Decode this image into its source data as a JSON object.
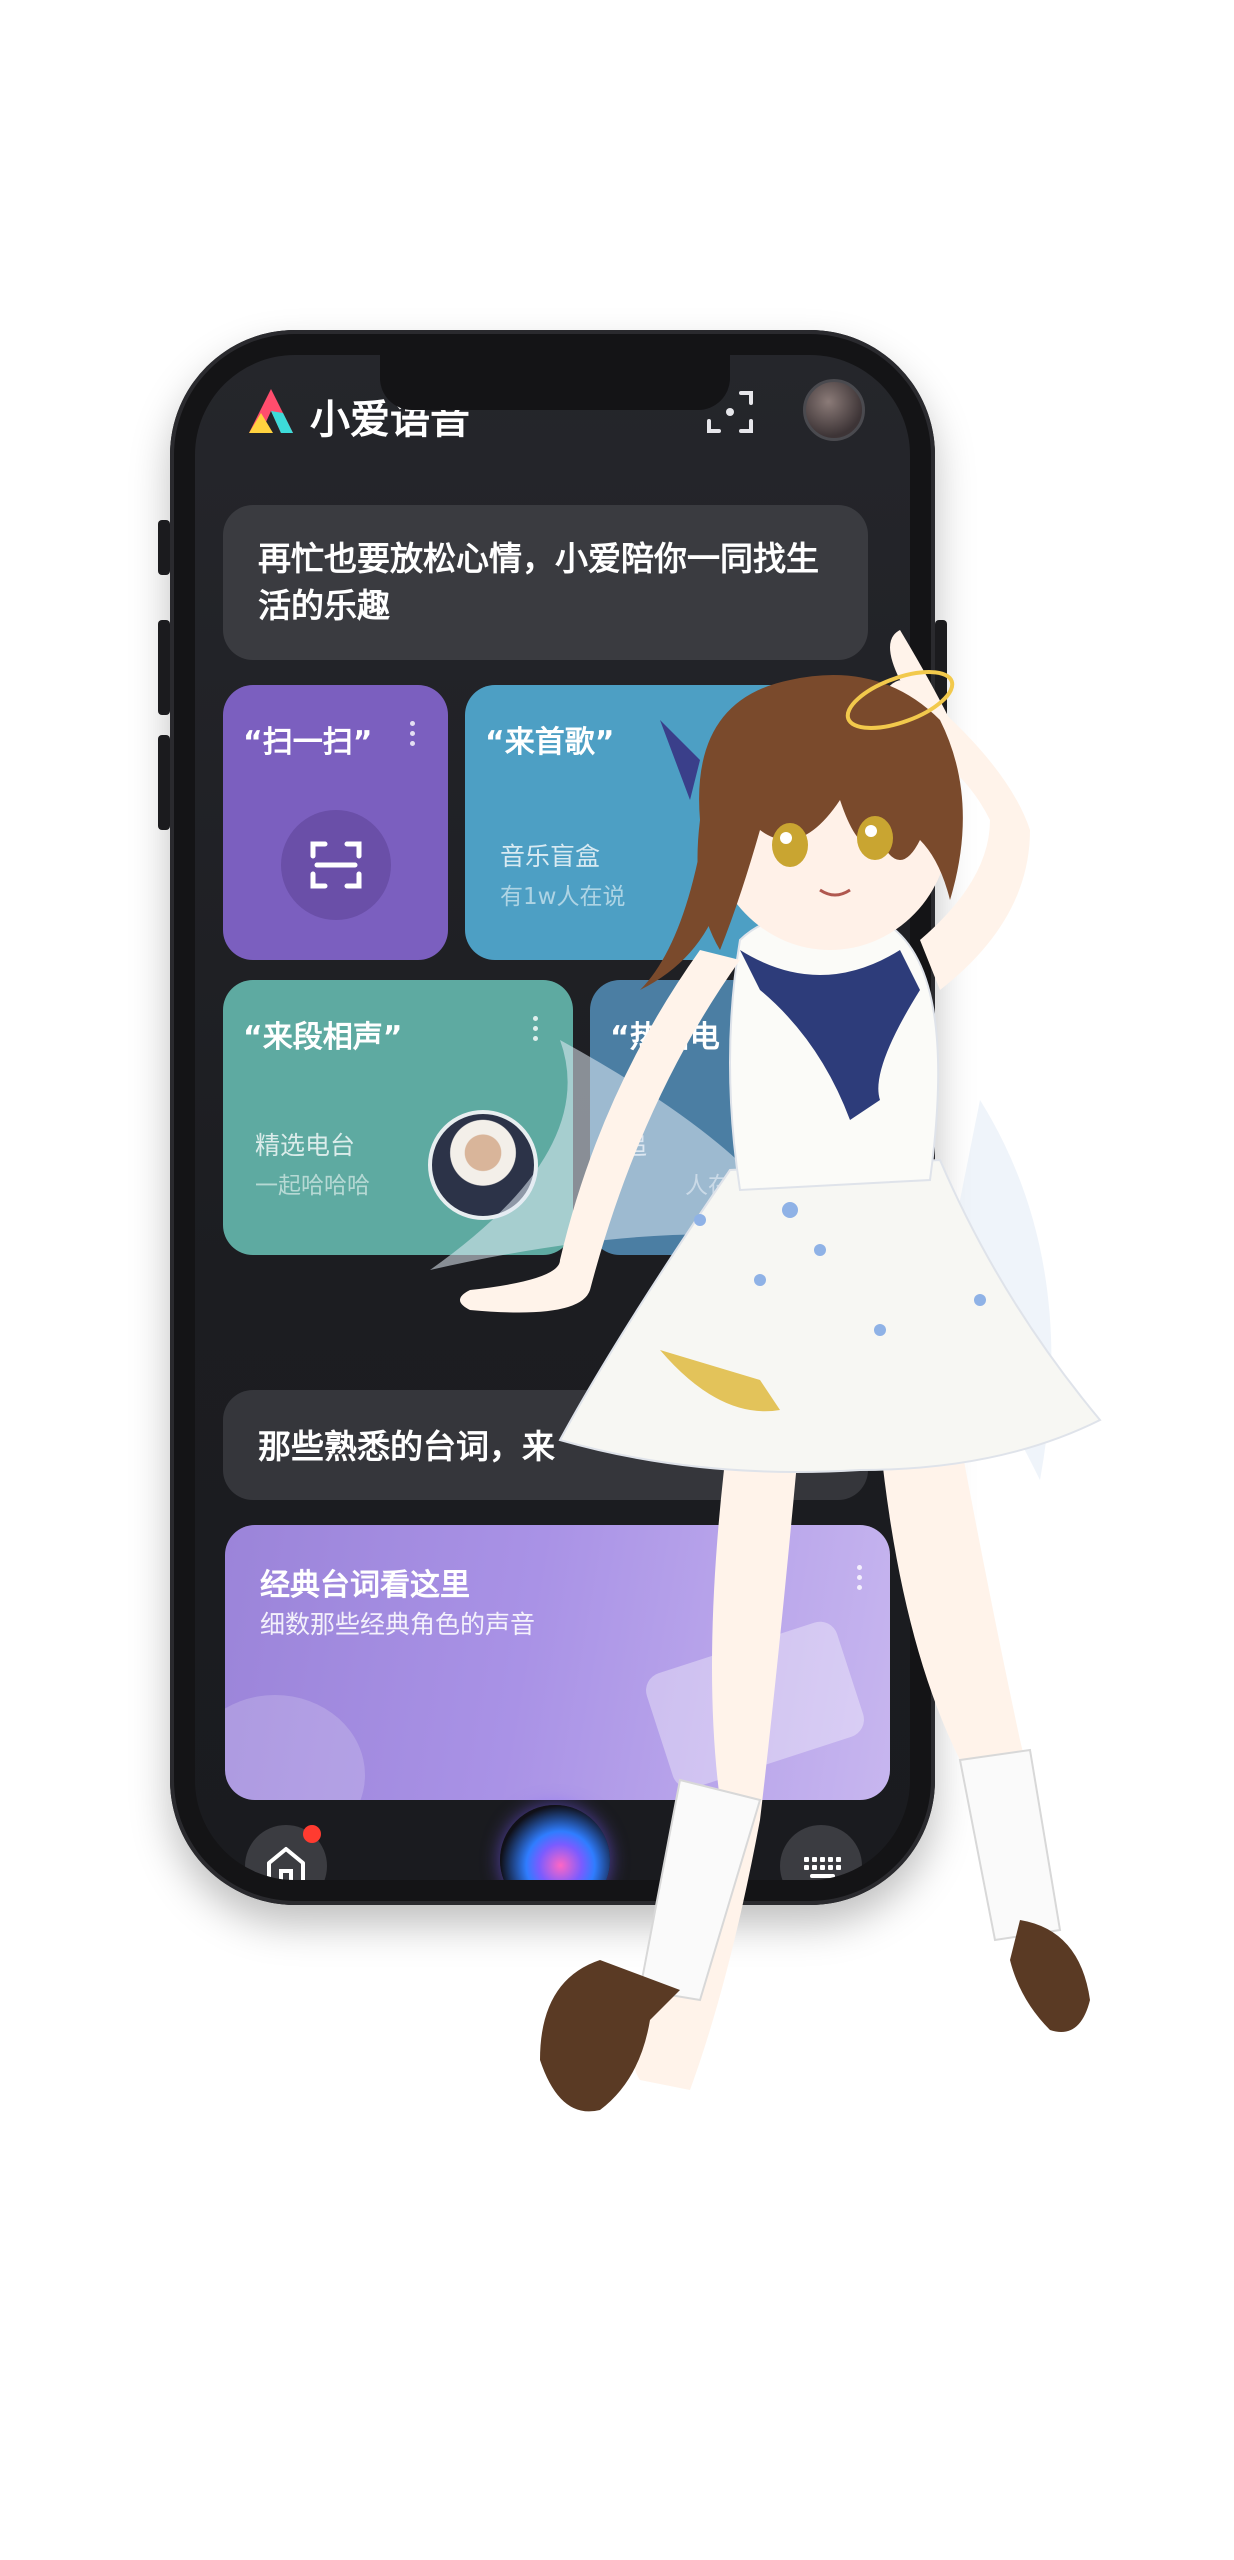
{
  "app": {
    "title": "小爱语音"
  },
  "greeting": {
    "text": "再忙也要放松心情，小爱陪你一同找生活的乐趣"
  },
  "cards": {
    "scan": {
      "title": "“扫一扫”"
    },
    "music": {
      "title": "“来首歌”",
      "subtitle": "音乐盲盒",
      "meta": "有1w人在说"
    },
    "crosstalk": {
      "title": "“来段相声”",
      "subtitle": "精选电台",
      "meta": "一起哈哈哈"
    },
    "radio": {
      "title": "“热播电",
      "subtitle": "追",
      "meta": "人在说"
    }
  },
  "section": {
    "title": "那些熟悉的台词，来"
  },
  "banner": {
    "title": "经典台词看这里",
    "subtitle": "细数那些经典角色的声音"
  },
  "colors": {
    "scan_card": "#7b5fbf",
    "music_card": "#4d9fc4",
    "crosstalk_card": "#5eaaa1",
    "radio_card": "#4b7ea3",
    "badge": "#ff3b30"
  },
  "icons": [
    "brand-logo-icon",
    "scan-icon",
    "avatar",
    "home-icon",
    "voice-orb-icon",
    "keyboard-icon",
    "more-dots-icon"
  ]
}
